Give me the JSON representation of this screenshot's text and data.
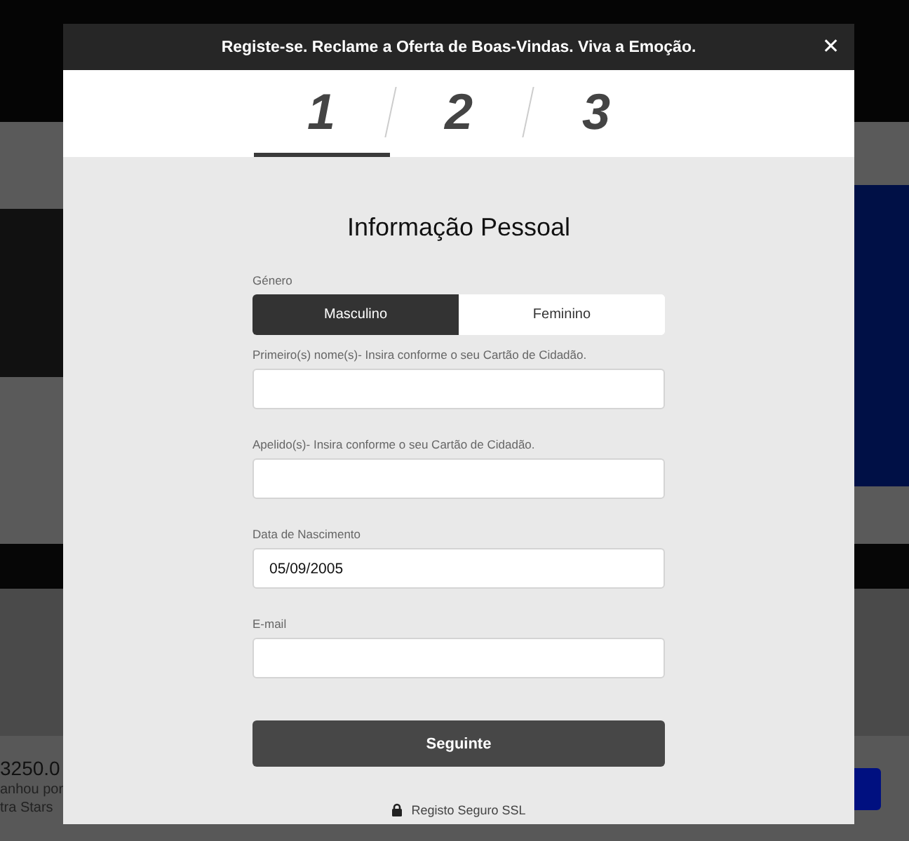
{
  "background": {
    "promo": {
      "amount": "3250.0",
      "line_1": "anhou por",
      "line_2": "tra Stars"
    }
  },
  "modal": {
    "title": "Registe-se. Reclame a Oferta de Boas-Vindas. Viva a Emoção.",
    "close": "✕",
    "steps": [
      {
        "label": "1",
        "selected": true
      },
      {
        "label": "2",
        "selected": false
      },
      {
        "label": "3",
        "selected": false
      }
    ],
    "heading": "Informação Pessoal",
    "gender": {
      "label": "Género",
      "options": [
        {
          "label": "Masculino",
          "selected": true
        },
        {
          "label": "Feminino",
          "selected": false
        }
      ]
    },
    "fields": [
      {
        "label": "Primeiro(s) nome(s)- Insira conforme o seu Cartão de Cidadão."
      },
      {
        "label": "Apelido(s)- Insira conforme o seu Cartão de Cidadão."
      },
      {
        "label": "Data de Nascimento",
        "value": "05/09/2005"
      },
      {
        "label": "E-mail"
      }
    ],
    "submit": "Seguinte",
    "secure_note": "Registo Seguro SSL"
  }
}
